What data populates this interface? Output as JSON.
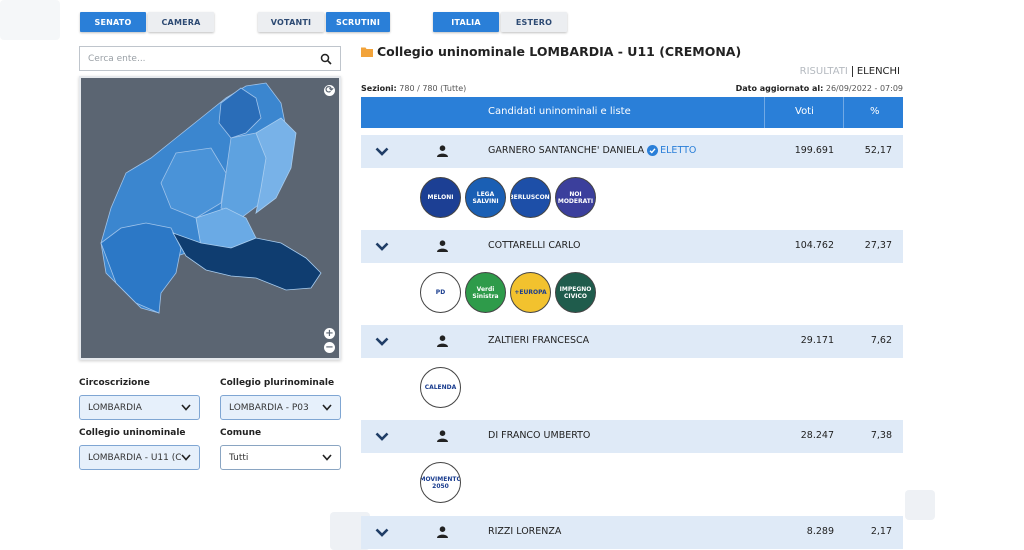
{
  "toggles": {
    "chamber": [
      {
        "label": "SENATO",
        "active": true
      },
      {
        "label": "CAMERA",
        "active": false
      }
    ],
    "mode": [
      {
        "label": "VOTANTI",
        "active": false
      },
      {
        "label": "SCRUTINI",
        "active": true
      }
    ],
    "area": [
      {
        "label": "ITALIA",
        "active": true
      },
      {
        "label": "ESTERO",
        "active": false
      }
    ]
  },
  "search": {
    "placeholder": "Cerca ente..."
  },
  "map": {
    "zoom_in": "+",
    "zoom_out": "−"
  },
  "filters": {
    "circoscrizione": {
      "label": "Circoscrizione",
      "value": "LOMBARDIA"
    },
    "plurinominale": {
      "label": "Collegio plurinominale",
      "value": "LOMBARDIA - P03"
    },
    "uninominale": {
      "label": "Collegio uninominale",
      "value": "LOMBARDIA - U11 (C"
    },
    "comune": {
      "label": "Comune",
      "value": "Tutti"
    }
  },
  "results": {
    "title": "Collegio uninominale LOMBARDIA - U11 (CREMONA)",
    "tab_risultati": "RISULTATI",
    "tab_elenchi": "ELENCHI",
    "sezioni_label": "Sezioni:",
    "sezioni_value": " 780 / 780 (Tutte)",
    "updated_label": "Dato aggiornato al:",
    "updated_value": " 26/09/2022 - 07:09",
    "col_candidates": "Candidati uninominali e liste",
    "col_votes": "Voti",
    "col_pct": "%",
    "candidates": [
      {
        "name": "GARNERO SANTANCHE' DANIELA",
        "elected": "ELETTO",
        "votes": "199.691",
        "pct": "52,17",
        "logos": [
          {
            "text": "MELONI",
            "bg": "#1c3f94"
          },
          {
            "text": "LEGA SALVINI",
            "bg": "#1a5fb4"
          },
          {
            "text": "BERLUSCONI",
            "bg": "#1d4fa8"
          },
          {
            "text": "NOI MODERATI",
            "bg": "#3b3f9c"
          }
        ]
      },
      {
        "name": "COTTARELLI CARLO",
        "elected": "",
        "votes": "104.762",
        "pct": "27,37",
        "logos": [
          {
            "text": "PD",
            "bg": "#ffffff"
          },
          {
            "text": "Verdi Sinistra",
            "bg": "#2e9b4a"
          },
          {
            "text": "+EUROPA",
            "bg": "#f2c22e"
          },
          {
            "text": "IMPEGNO CIVICO",
            "bg": "#1f5c4c"
          }
        ]
      },
      {
        "name": "ZALTIERI FRANCESCA",
        "elected": "",
        "votes": "29.171",
        "pct": "7,62",
        "logos": [
          {
            "text": "CALENDA",
            "bg": "#ffffff"
          }
        ]
      },
      {
        "name": "DI FRANCO UMBERTO",
        "elected": "",
        "votes": "28.247",
        "pct": "7,38",
        "logos": [
          {
            "text": "MOVIMENTO 2050",
            "bg": "#ffffff"
          }
        ]
      },
      {
        "name": "RIZZI LORENZA",
        "elected": "",
        "votes": "8.289",
        "pct": "2,17",
        "logos": []
      }
    ]
  },
  "colors": {
    "accent": "#2a7fd8",
    "row": "#dfeaf7",
    "map_bg": "#5b6572"
  }
}
